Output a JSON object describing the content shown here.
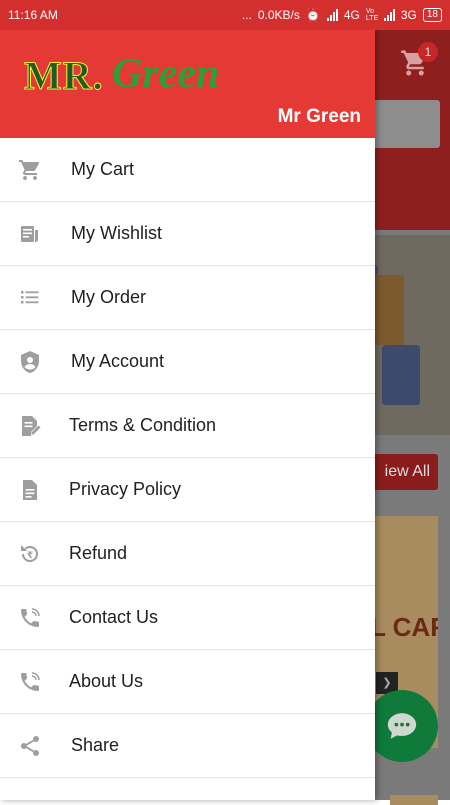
{
  "status_bar": {
    "time": "11:16 AM",
    "dots": "...",
    "speed": "0.0KB/s",
    "network1": "4G",
    "volte": "Vo LTE",
    "network2": "3G",
    "battery": "18"
  },
  "drawer": {
    "logo_mr": "MR.",
    "logo_green": "Green",
    "user_name": "Mr Green",
    "items": [
      {
        "label": "My Cart",
        "icon": "cart-icon"
      },
      {
        "label": "My Wishlist",
        "icon": "wishlist-icon"
      },
      {
        "label": "My Order",
        "icon": "list-icon"
      },
      {
        "label": "My Account",
        "icon": "account-shield-icon"
      },
      {
        "label": "Terms & Condition",
        "icon": "document-edit-icon"
      },
      {
        "label": "Privacy Policy",
        "icon": "document-icon"
      },
      {
        "label": "Refund",
        "icon": "refund-icon"
      },
      {
        "label": "Contact Us",
        "icon": "phone-icon"
      },
      {
        "label": "About Us",
        "icon": "phone-icon"
      },
      {
        "label": "Share",
        "icon": "share-icon"
      }
    ]
  },
  "background": {
    "cart_badge": "1",
    "view_all_label": "iew All",
    "card_text": "L CARE",
    "play_glyph": "❯"
  },
  "colors": {
    "header_red": "#e53935",
    "status_red": "#d32f2f",
    "icon_grey": "#9e9e9e",
    "fab_green": "#0f7a3a"
  }
}
